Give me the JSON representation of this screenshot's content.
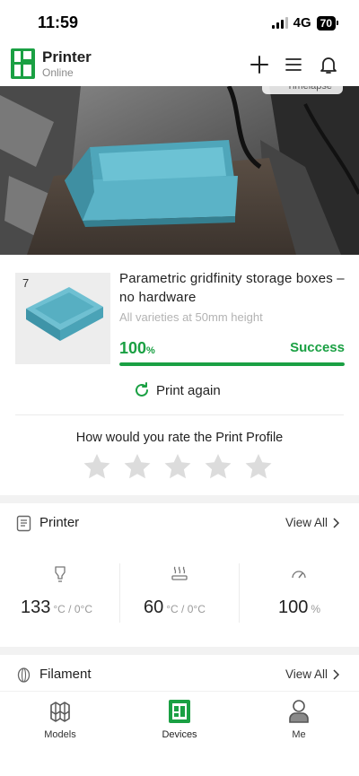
{
  "status_bar": {
    "time": "11:59",
    "network": "4G",
    "battery": "70"
  },
  "header": {
    "title": "Printer",
    "status": "Online",
    "icons": [
      "plus-icon",
      "menu-icon",
      "bell-icon"
    ]
  },
  "camera": {
    "badge_label": "Timelapse"
  },
  "print_job": {
    "plate_number": "7",
    "title": "Parametric gridfinity storage boxes – no hardware",
    "subtitle": "All varieties at 50mm height",
    "progress_value": "100",
    "progress_unit": "%",
    "progress_fraction": 1.0,
    "status": "Success",
    "print_again_label": "Print again"
  },
  "rating": {
    "question": "How would you rate the Print Profile",
    "stars_total": 5,
    "stars_filled": 0
  },
  "printer_section": {
    "title": "Printer",
    "view_all": "View All",
    "stats": [
      {
        "icon": "nozzle-icon",
        "value": "133",
        "unit": "°C / 0°C"
      },
      {
        "icon": "heatbed-icon",
        "value": "60",
        "unit": "°C / 0°C"
      },
      {
        "icon": "speed-gauge-icon",
        "value": "100",
        "unit": "%"
      }
    ]
  },
  "filament_section": {
    "title": "Filament",
    "view_all": "View All"
  },
  "tab_bar": {
    "tabs": [
      {
        "label": "Models",
        "icon": "models-icon",
        "active": false
      },
      {
        "label": "Devices",
        "icon": "devices-icon",
        "active": true
      },
      {
        "label": "Me",
        "icon": "profile-icon",
        "active": false
      }
    ]
  },
  "colors": {
    "accent": "#1aa043",
    "star_empty": "#dcdcdc",
    "print_color": "#5bb3c7"
  }
}
